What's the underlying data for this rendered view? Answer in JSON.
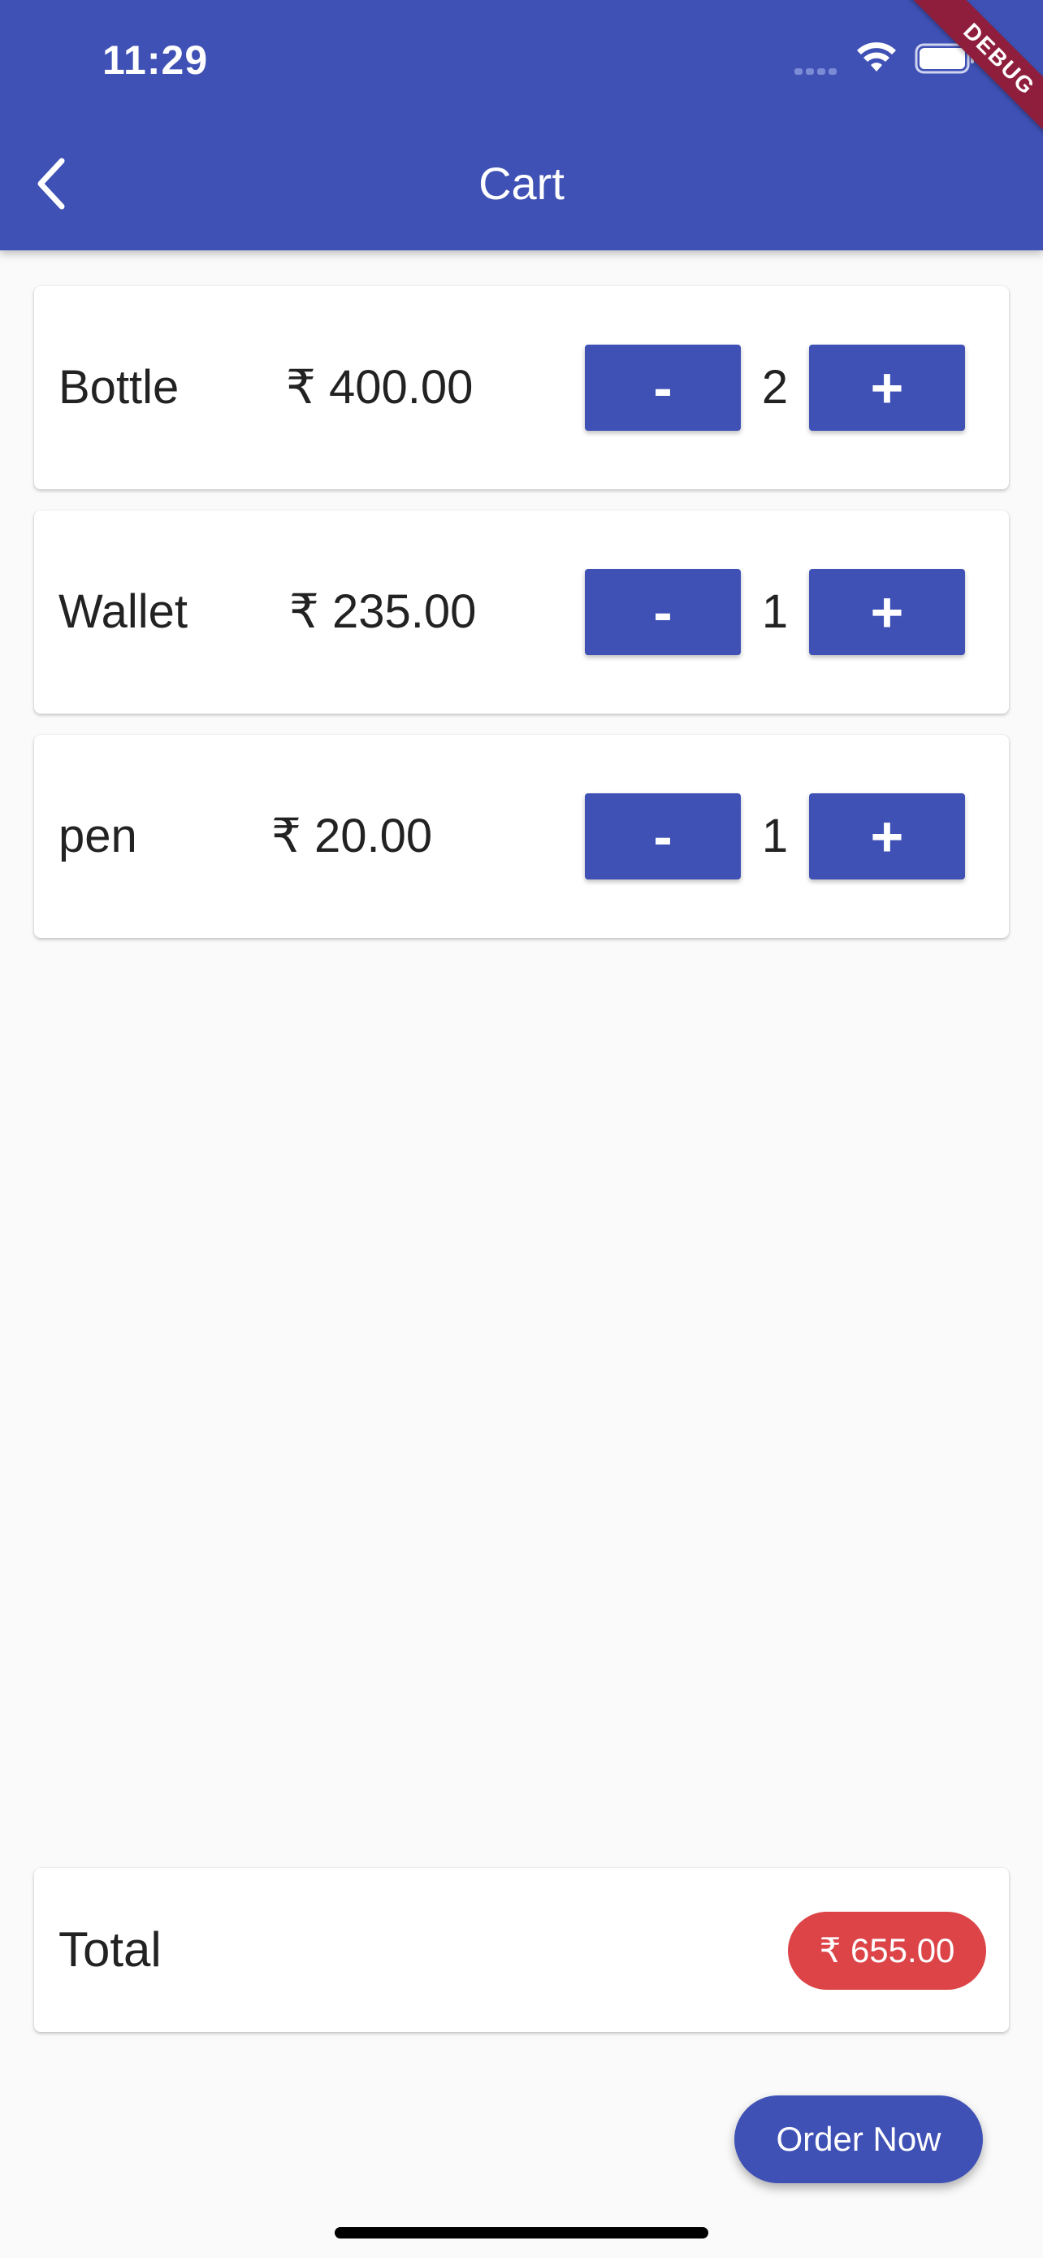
{
  "status_bar": {
    "time": "11:29"
  },
  "debug_banner": "DEBUG",
  "app_bar": {
    "title": "Cart"
  },
  "currency_symbol": "₹",
  "items": [
    {
      "name": "Bottle",
      "price": "₹ 400.00",
      "minus_label": "-",
      "quantity": "2",
      "plus_label": "+"
    },
    {
      "name": "Wallet",
      "price": "₹ 235.00",
      "minus_label": "-",
      "quantity": "1",
      "plus_label": "+"
    },
    {
      "name": "pen",
      "price": "₹ 20.00",
      "minus_label": "-",
      "quantity": "1",
      "plus_label": "+"
    }
  ],
  "total": {
    "label": "Total",
    "amount": "₹ 655.00"
  },
  "order_button_label": "Order Now",
  "colors": {
    "primary": "#3f51b5",
    "badge": "#dc4448",
    "background": "#fafafa",
    "debug": "#8e1e3c"
  },
  "icons": {
    "back": "back-arrow-icon",
    "wifi": "wifi-icon",
    "battery": "battery-icon",
    "signal": "signal-icon"
  }
}
